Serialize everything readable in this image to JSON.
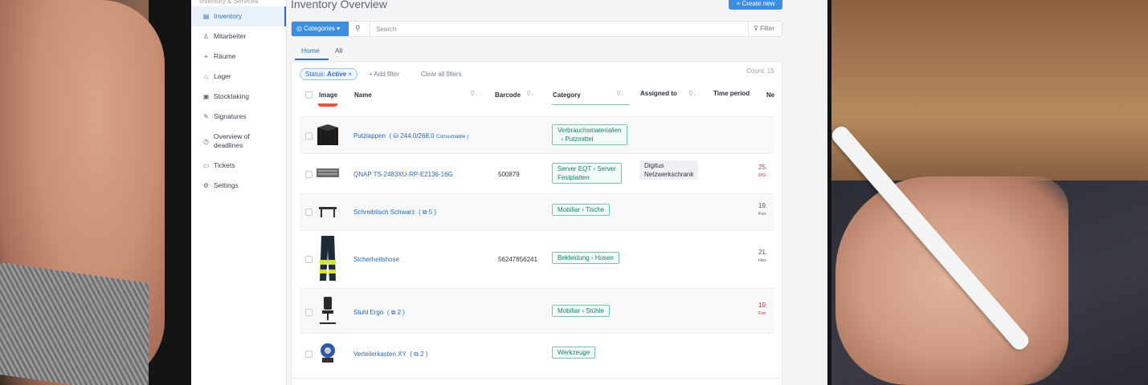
{
  "sidebar": {
    "section_label": "Inventory & Services",
    "items": [
      {
        "label": "Inventory",
        "icon": "boxes-icon",
        "glyph": "▤"
      },
      {
        "label": "Mitarbeiter",
        "icon": "user-icon",
        "glyph": "♙"
      },
      {
        "label": "Räume",
        "icon": "location-icon",
        "glyph": "⌖"
      },
      {
        "label": "Lager",
        "icon": "warehouse-icon",
        "glyph": "⌂"
      },
      {
        "label": "Stocktaking",
        "icon": "clipboard-icon",
        "glyph": "▣"
      },
      {
        "label": "Signatures",
        "icon": "signature-icon",
        "glyph": "✎"
      },
      {
        "label": "Overview of deadlines",
        "icon": "clock-icon",
        "glyph": "◷"
      },
      {
        "label": "Tickets",
        "icon": "ticket-icon",
        "glyph": "▭"
      },
      {
        "label": "Settings",
        "icon": "gear-icon",
        "glyph": "⚙"
      }
    ]
  },
  "header": {
    "title": "Inventory Overview",
    "create_label": "Create new"
  },
  "search": {
    "categories_label": "Categories",
    "placeholder": "Search",
    "filter_label": "Filter"
  },
  "tabs": [
    {
      "label": "Home",
      "active": true
    },
    {
      "label": "All",
      "active": false
    }
  ],
  "filters": {
    "status_prefix": "Status:",
    "status_value": "Active",
    "add_label": "Add filter",
    "clear_label": "Clear all filters",
    "count_label": "Count: 15"
  },
  "table": {
    "columns": {
      "image": "Image",
      "name": "Name",
      "barcode": "Barcode",
      "category": "Category",
      "assigned": "Assigned to",
      "time": "Time period",
      "next": "Ne"
    },
    "rows": [
      {
        "name": "Putzlappen",
        "extra": "( ⛁ 244.0/268.0",
        "extra_small": "Consumable )",
        "barcode": "",
        "cat_line1": "Verbrauchsmaterialien",
        "cat_line2": "›  Putzmittel",
        "assigned": "",
        "next1": "",
        "next2": "",
        "thumb": "box-thumb"
      },
      {
        "name": "QNAP TS-2483XU-RP-E2136-16G",
        "extra": "",
        "extra_small": "",
        "barcode": "500879",
        "cat_line1": "Server EQT  ›  Server",
        "cat_line2": "Festplatten",
        "assigned_line1": "Digitus",
        "assigned_line2": "Netzwerkschrank",
        "next1": "25.",
        "next2": "DGI",
        "thumb": "server-thumb"
      },
      {
        "name": "Schreibtisch Schwarz",
        "extra": "( ⧉ 5 )",
        "extra_small": "",
        "barcode": "",
        "cat_line1": "Mobiliar  ›  Tische",
        "cat_line2": "",
        "assigned": "",
        "next1": "19.",
        "next2": "Fun",
        "thumb": "desk-thumb"
      },
      {
        "name": "Sicherheitshose",
        "extra": "",
        "extra_small": "",
        "barcode": "56247856241",
        "cat_line1": "Bekleidung  ›  Hosen",
        "cat_line2": "",
        "assigned": "",
        "next1": "21.",
        "next2": "Hos",
        "thumb": "trousers-thumb"
      },
      {
        "name": "Stuhl Ergo",
        "extra": "( ⧉ 2 )",
        "extra_small": "",
        "barcode": "",
        "cat_line1": "Mobiliar  ›  Stühle",
        "cat_line2": "",
        "assigned": "",
        "next1": "19.",
        "next2": "Fun",
        "thumb": "chair-thumb"
      },
      {
        "name": "Verteilerkasten XY",
        "extra": "( ⧉ 2 )",
        "extra_small": "",
        "barcode": "",
        "cat_line1": "Werkzeuge",
        "cat_line2": "",
        "assigned": "",
        "next1": "",
        "next2": "",
        "thumb": "cable-reel-thumb"
      }
    ]
  },
  "colors": {
    "accent": "#3f8de0",
    "link": "#2a67b8",
    "tag_border": "#72c6b3",
    "tag_text": "#1e7e6a",
    "due_red": "#d0312d"
  }
}
